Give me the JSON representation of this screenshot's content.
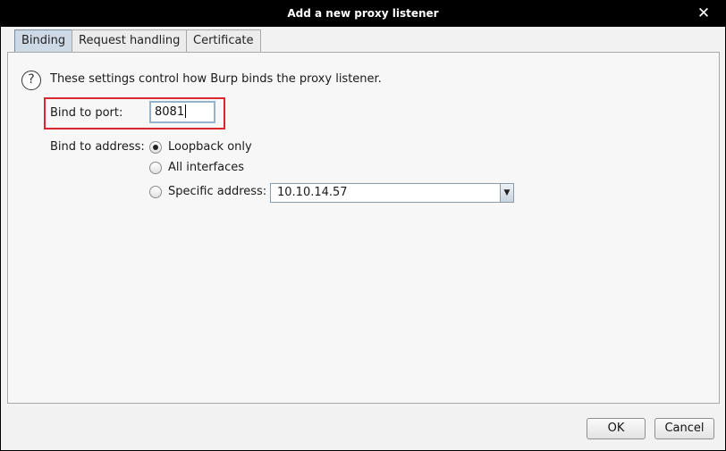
{
  "window": {
    "title": "Add a new proxy listener"
  },
  "tabs": [
    {
      "label": "Binding",
      "active": true
    },
    {
      "label": "Request handling",
      "active": false
    },
    {
      "label": "Certificate",
      "active": false
    }
  ],
  "binding": {
    "help_icon": "question-mark-icon",
    "description": "These settings control how Burp binds the proxy listener.",
    "port_label": "Bind to port:",
    "port_value": "8081",
    "address_label": "Bind to address:",
    "address_options": [
      {
        "label": "Loopback only",
        "selected": true
      },
      {
        "label": "All interfaces",
        "selected": false
      },
      {
        "label": "Specific address:",
        "selected": false
      }
    ],
    "specific_address_value": "10.10.14.57"
  },
  "buttons": {
    "ok": "OK",
    "cancel": "Cancel"
  },
  "colors": {
    "highlight_box": "#d9272e",
    "active_tab": "#cdd9e4",
    "titlebar": "#000000"
  }
}
